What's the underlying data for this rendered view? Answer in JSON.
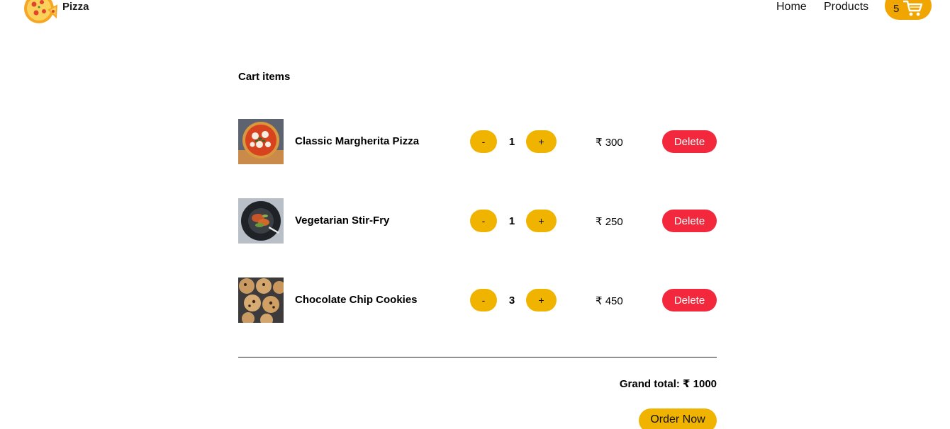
{
  "brand": {
    "name": "Pizza"
  },
  "nav": {
    "links": [
      "Home",
      "Products"
    ],
    "cart_count": "5"
  },
  "cart": {
    "title": "Cart items",
    "minus_label": "-",
    "plus_label": "+",
    "delete_label": "Delete",
    "items": [
      {
        "name": "Classic Margherita Pizza",
        "quantity": "1",
        "price": "₹ 300",
        "image": "margherita-pizza-photo"
      },
      {
        "name": "Vegetarian Stir-Fry",
        "quantity": "1",
        "price": "₹ 250",
        "image": "stir-fry-bowl-photo"
      },
      {
        "name": "Chocolate Chip Cookies",
        "quantity": "3",
        "price": "₹ 450",
        "image": "cookies-photo"
      }
    ],
    "grand_total": "Grand total: ₹ 1000",
    "order_label": "Order Now"
  },
  "colors": {
    "accent_yellow": "#f0b400",
    "cart_orange": "#f0a500",
    "delete_red": "#f4283c"
  }
}
